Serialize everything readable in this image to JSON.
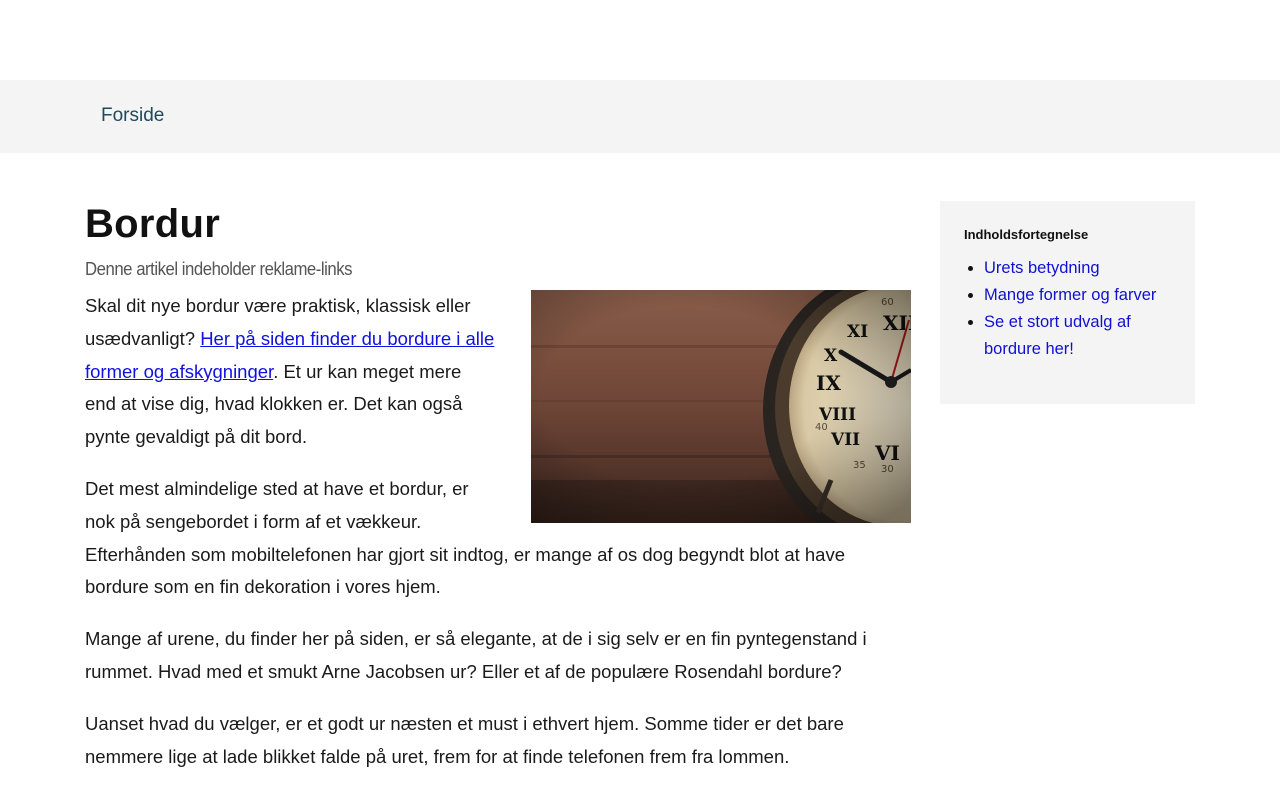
{
  "nav": {
    "home_label": "Forside"
  },
  "article": {
    "title": "Bordur",
    "ad_notice": "Denne artikel indeholder reklame-links",
    "p1_before": "Skal dit nye bordur være praktisk, klassisk eller usædvanligt? ",
    "p1_link": "Her på siden finder du bordure i alle former og afskygninger",
    "p1_after": ". Et ur kan meget mere end at vise dig, hvad klokken er. Det kan også pynte gevaldigt på dit bord.",
    "p2": "Det mest almindelige sted at have et bordur, er nok på sengebordet i form af et vækkeur. Efterhånden som mobiltelefonen har gjort sit indtog, er mange af os dog begyndt blot at have bordure som en fin dekoration i vores hjem.",
    "p3": "Mange af urene, du finder her på siden, er så elegante, at de i sig selv er en fin pyntegenstand i rummet. Hvad med et smukt Arne Jacobsen ur? Eller et af de populære Rosendahl bordure?",
    "p4": "Uanset hvad du vælger, er et godt ur næsten et must i ethvert hjem. Somme tider er det bare nemmere lige at lade blikket falde på uret, frem for at finde telefonen frem fra lommen."
  },
  "sidebar": {
    "toc_title": "Indholdsfortegnelse",
    "items": [
      {
        "label": "Urets betydning"
      },
      {
        "label": "Mange former og farver"
      },
      {
        "label": "Se et stort udvalg af bordure her!"
      }
    ]
  },
  "colors": {
    "link": "#1010e0",
    "nav_link": "#1e4a5c",
    "navbar_bg": "#f4f4f4",
    "sidebar_bg": "#f4f4f4"
  }
}
